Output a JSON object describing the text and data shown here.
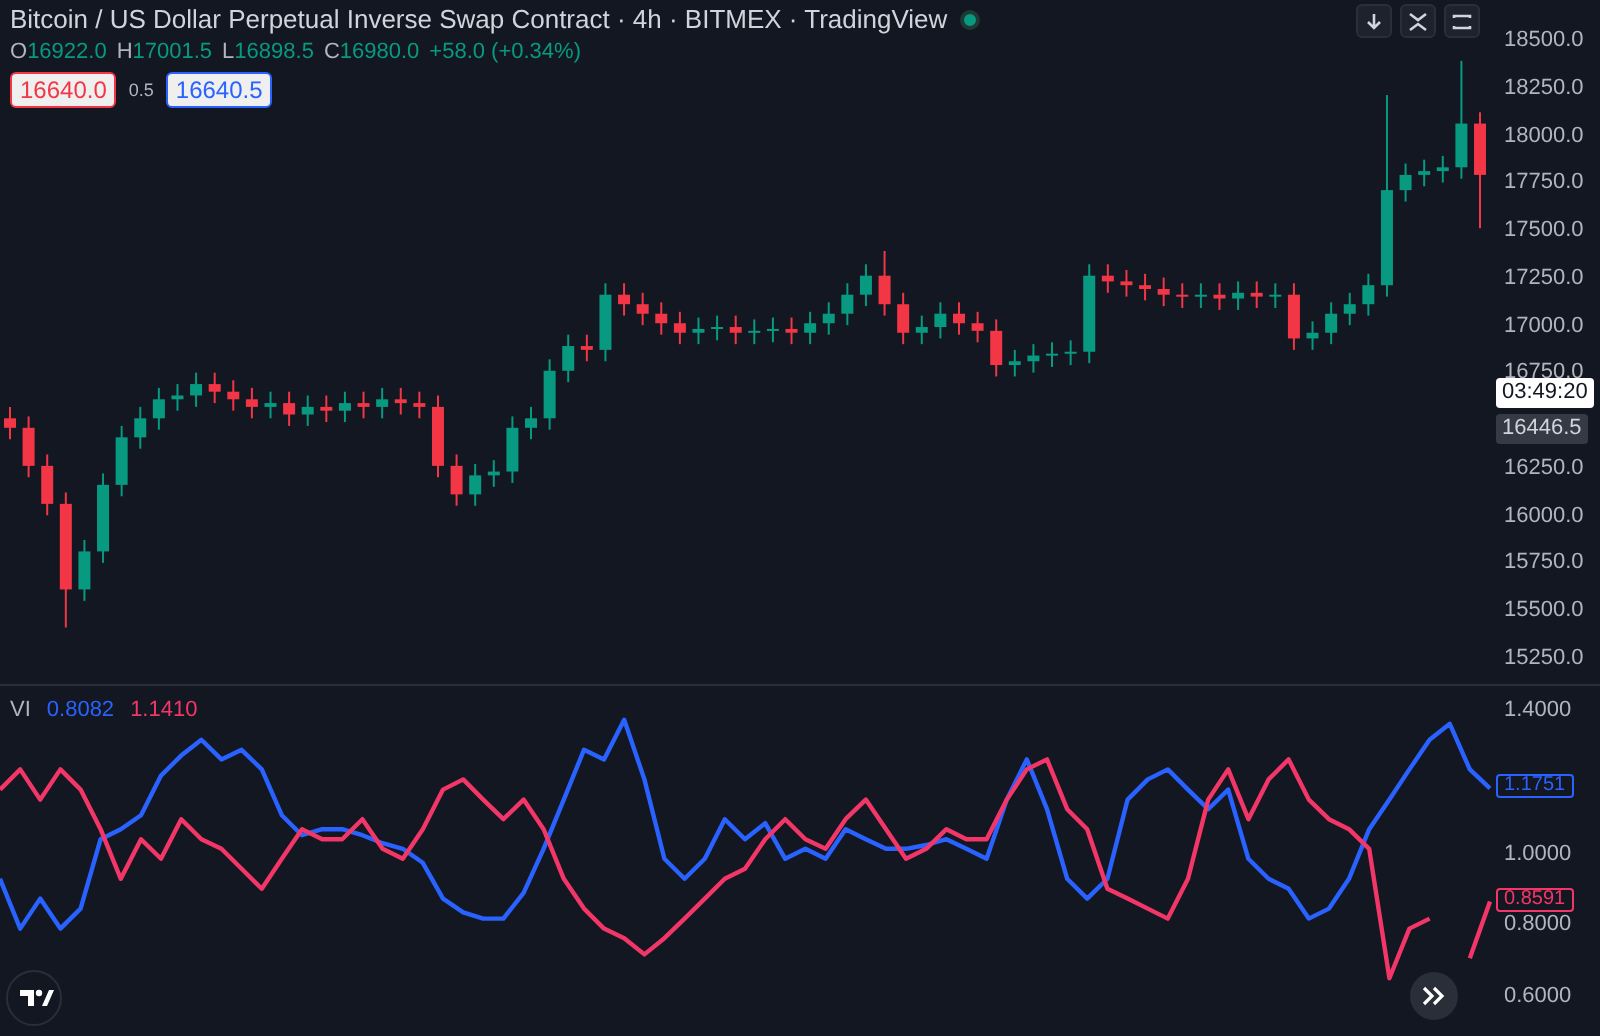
{
  "header": {
    "title": "Bitcoin / US Dollar Perpetual Inverse Swap Contract · 4h · BITMEX · TradingView",
    "market_open": true,
    "ohlc": [
      {
        "label": "O",
        "value": "16922.0"
      },
      {
        "label": "H",
        "value": "17001.5"
      },
      {
        "label": "L",
        "value": "16898.5"
      },
      {
        "label": "C",
        "value": "16980.0"
      }
    ],
    "change": "+58.0 (+0.34%)",
    "bid": "16640.0",
    "spread": "0.5",
    "ask": "16640.5"
  },
  "main_chart": {
    "chart_data": {
      "type": "candlestick",
      "ylim": [
        15250,
        18500
      ],
      "yticks": [
        {
          "value": 18500,
          "label": "18500.0"
        },
        {
          "value": 18250,
          "label": "18250.0"
        },
        {
          "value": 18000,
          "label": "18000.0"
        },
        {
          "value": 17750,
          "label": "17750.0"
        },
        {
          "value": 17500,
          "label": "17500.0"
        },
        {
          "value": 17250,
          "label": "17250.0"
        },
        {
          "value": 17000,
          "label": "17000.0"
        },
        {
          "value": 16750,
          "label": "16750.0"
        },
        {
          "value": 16250,
          "label": "16250.0"
        },
        {
          "value": 16000,
          "label": "16000.0"
        },
        {
          "value": 15750,
          "label": "15750.0"
        },
        {
          "value": 15500,
          "label": "15500.0"
        },
        {
          "value": 15250,
          "label": "15250.0"
        }
      ],
      "ohlc": [
        [
          16500,
          16560,
          16390,
          16450
        ],
        [
          16450,
          16510,
          16190,
          16250
        ],
        [
          16250,
          16310,
          15990,
          16050
        ],
        [
          16050,
          16110,
          15400,
          15600
        ],
        [
          15600,
          15860,
          15540,
          15800
        ],
        [
          15800,
          16210,
          15740,
          16150
        ],
        [
          16150,
          16460,
          16090,
          16400
        ],
        [
          16400,
          16560,
          16340,
          16500
        ],
        [
          16500,
          16660,
          16440,
          16600
        ],
        [
          16600,
          16680,
          16540,
          16620
        ],
        [
          16620,
          16740,
          16560,
          16680
        ],
        [
          16680,
          16740,
          16580,
          16640
        ],
        [
          16640,
          16700,
          16540,
          16600
        ],
        [
          16600,
          16660,
          16500,
          16560
        ],
        [
          16560,
          16640,
          16500,
          16580
        ],
        [
          16580,
          16640,
          16460,
          16520
        ],
        [
          16520,
          16620,
          16460,
          16560
        ],
        [
          16560,
          16620,
          16480,
          16540
        ],
        [
          16540,
          16640,
          16480,
          16580
        ],
        [
          16580,
          16640,
          16500,
          16560
        ],
        [
          16560,
          16660,
          16500,
          16600
        ],
        [
          16600,
          16660,
          16520,
          16580
        ],
        [
          16580,
          16640,
          16500,
          16560
        ],
        [
          16560,
          16620,
          16190,
          16250
        ],
        [
          16250,
          16310,
          16040,
          16100
        ],
        [
          16100,
          16260,
          16040,
          16200
        ],
        [
          16200,
          16280,
          16140,
          16220
        ],
        [
          16220,
          16510,
          16160,
          16450
        ],
        [
          16450,
          16560,
          16390,
          16500
        ],
        [
          16500,
          16810,
          16440,
          16750
        ],
        [
          16750,
          16940,
          16690,
          16880
        ],
        [
          16880,
          16940,
          16800,
          16860
        ],
        [
          16860,
          17210,
          16800,
          17150
        ],
        [
          17150,
          17210,
          17040,
          17100
        ],
        [
          17100,
          17160,
          16990,
          17050
        ],
        [
          17050,
          17110,
          16940,
          17000
        ],
        [
          17000,
          17060,
          16890,
          16950
        ],
        [
          16950,
          17030,
          16890,
          16970
        ],
        [
          16970,
          17040,
          16910,
          16980
        ],
        [
          16980,
          17040,
          16890,
          16950
        ],
        [
          16950,
          17020,
          16890,
          16960
        ],
        [
          16960,
          17030,
          16900,
          16970
        ],
        [
          16970,
          17030,
          16890,
          16950
        ],
        [
          16950,
          17060,
          16890,
          17000
        ],
        [
          17000,
          17110,
          16940,
          17050
        ],
        [
          17050,
          17210,
          16990,
          17150
        ],
        [
          17150,
          17310,
          17090,
          17250
        ],
        [
          17250,
          17380,
          17040,
          17100
        ],
        [
          17100,
          17160,
          16890,
          16950
        ],
        [
          16950,
          17040,
          16890,
          16980
        ],
        [
          16980,
          17110,
          16920,
          17050
        ],
        [
          17050,
          17110,
          16940,
          17000
        ],
        [
          17000,
          17060,
          16900,
          16960
        ],
        [
          16960,
          17020,
          16720,
          16780
        ],
        [
          16780,
          16860,
          16720,
          16800
        ],
        [
          16800,
          16890,
          16740,
          16830
        ],
        [
          16830,
          16900,
          16770,
          16840
        ],
        [
          16840,
          16910,
          16780,
          16850
        ],
        [
          16850,
          17310,
          16790,
          17250
        ],
        [
          17250,
          17310,
          17160,
          17220
        ],
        [
          17220,
          17280,
          17140,
          17200
        ],
        [
          17200,
          17260,
          17120,
          17180
        ],
        [
          17180,
          17240,
          17090,
          17150
        ],
        [
          17150,
          17210,
          17080,
          17140
        ],
        [
          17140,
          17210,
          17080,
          17150
        ],
        [
          17150,
          17210,
          17070,
          17130
        ],
        [
          17130,
          17220,
          17070,
          17160
        ],
        [
          17160,
          17220,
          17080,
          17140
        ],
        [
          17140,
          17210,
          17080,
          17150
        ],
        [
          17150,
          17210,
          16860,
          16920
        ],
        [
          16920,
          17010,
          16860,
          16950
        ],
        [
          16950,
          17110,
          16890,
          17050
        ],
        [
          17050,
          17160,
          16990,
          17100
        ],
        [
          17100,
          17260,
          17040,
          17200
        ],
        [
          17200,
          18200,
          17140,
          17700
        ],
        [
          17700,
          17840,
          17640,
          17780
        ],
        [
          17780,
          17860,
          17720,
          17800
        ],
        [
          17800,
          17880,
          17740,
          17820
        ],
        [
          17820,
          18380,
          17760,
          18050
        ],
        [
          18050,
          18110,
          17500,
          17780
        ]
      ]
    },
    "badges": [
      {
        "text": "03:49:20",
        "kind": "countdown"
      },
      {
        "text": "16446.5",
        "kind": "crosshair"
      }
    ]
  },
  "indicator": {
    "name": "VI",
    "readings": [
      {
        "text": "0.8082",
        "color": "#2962ff"
      },
      {
        "text": "1.1410",
        "color": "#f23668"
      }
    ],
    "chart_data": {
      "type": "line",
      "ylim": [
        0.6,
        1.4
      ],
      "yticks": [
        {
          "value": 1.4,
          "label": "1.4000"
        },
        {
          "value": 1.0,
          "label": "1.0000"
        },
        {
          "value": 0.8,
          "label": "0.8000"
        },
        {
          "value": 0.6,
          "label": "0.6000"
        }
      ],
      "series": [
        {
          "color": "#2962ff",
          "values": [
            0.922,
            0.783,
            0.867,
            0.783,
            0.839,
            1.033,
            1.061,
            1.1,
            1.211,
            1.267,
            1.311,
            1.256,
            1.283,
            1.228,
            1.1,
            1.044,
            1.061,
            1.061,
            1.044,
            1.022,
            1.006,
            0.967,
            0.867,
            0.828,
            0.811,
            0.811,
            0.883,
            1.006,
            1.144,
            1.283,
            1.256,
            1.367,
            1.2,
            0.978,
            0.922,
            0.978,
            1.089,
            1.033,
            1.078,
            0.978,
            1.006,
            0.978,
            1.061,
            1.033,
            1.006,
            1.006,
            1.017,
            1.033,
            1.006,
            0.978,
            1.144,
            1.256,
            1.117,
            0.922,
            0.867,
            0.922,
            1.144,
            1.2,
            1.228,
            1.172,
            1.117,
            1.172,
            0.978,
            0.922,
            0.894,
            0.811,
            0.839,
            0.922,
            1.061,
            1.144,
            1.228,
            1.311,
            1.356,
            1.228,
            1.175
          ]
        },
        {
          "color": "#f23668",
          "values": [
            1.172,
            1.228,
            1.144,
            1.228,
            1.172,
            1.061,
            0.922,
            1.033,
            0.978,
            1.089,
            1.033,
            1.006,
            0.95,
            0.894,
            0.978,
            1.061,
            1.033,
            1.033,
            1.089,
            1.006,
            0.978,
            1.061,
            1.172,
            1.2,
            1.144,
            1.089,
            1.144,
            1.061,
            0.922,
            0.839,
            0.783,
            0.756,
            0.711,
            0.756,
            0.811,
            0.867,
            0.922,
            0.95,
            1.033,
            1.089,
            1.033,
            1.006,
            1.089,
            1.144,
            1.061,
            0.978,
            1.006,
            1.061,
            1.033,
            1.033,
            1.144,
            1.228,
            1.256,
            1.117,
            1.061,
            0.894,
            0.867,
            0.839,
            0.811,
            0.922,
            1.144,
            1.228,
            1.089,
            1.2,
            1.256,
            1.144,
            1.089,
            1.061,
            1.006,
            0.644,
            0.783,
            0.811,
            null,
            0.7,
            0.859
          ]
        }
      ]
    },
    "last_values": [
      {
        "text": "1.1751"
      },
      {
        "text": "0.8591"
      }
    ]
  }
}
